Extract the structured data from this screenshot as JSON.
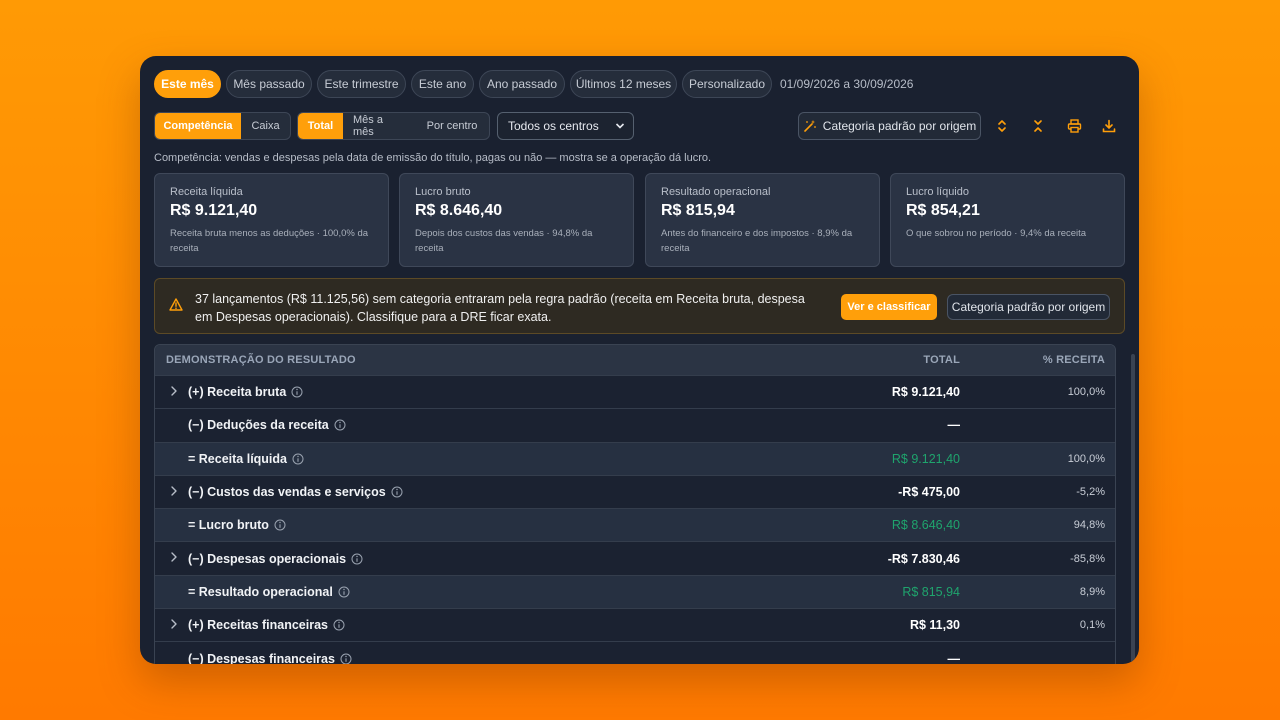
{
  "periods": [
    {
      "label": "Este mês",
      "active": true
    },
    {
      "label": "Mês passado",
      "active": false
    },
    {
      "label": "Este trimestre",
      "active": false
    },
    {
      "label": "Este ano",
      "active": false
    },
    {
      "label": "Ano passado",
      "active": false
    },
    {
      "label": "Últimos 12 meses",
      "active": false
    },
    {
      "label": "Personalizado",
      "active": false
    }
  ],
  "date_range": "01/09/2026 a 30/09/2026",
  "basis": {
    "competencia": "Competência",
    "caixa": "Caixa"
  },
  "view": {
    "total": "Total",
    "mes_a_mes": "Mês a mês",
    "por_centro": "Por centro"
  },
  "centro_select": "Todos os centros",
  "toolbar": {
    "categoria_padrao": "Categoria padrão por origem"
  },
  "note": "Competência: vendas e despesas pela data de emissão do título, pagas ou não — mostra se a operação dá lucro.",
  "cards": [
    {
      "label": "Receita líquida",
      "value": "R$ 9.121,40",
      "sub": "Receita bruta menos as deduções · 100,0% da receita"
    },
    {
      "label": "Lucro bruto",
      "value": "R$ 8.646,40",
      "sub": "Depois dos custos das vendas · 94,8% da receita"
    },
    {
      "label": "Resultado operacional",
      "value": "R$ 815,94",
      "sub": "Antes do financeiro e dos impostos · 8,9% da receita"
    },
    {
      "label": "Lucro líquido",
      "value": "R$ 854,21",
      "sub": "O que sobrou no período · 9,4% da receita"
    }
  ],
  "warning": {
    "text": "37 lançamentos (R$ 11.125,56) sem categoria entraram pela regra padrão (receita em Receita bruta, despesa em Despesas operacionais). Classifique para a DRE ficar exata.",
    "primary": "Ver e classificar",
    "secondary": "Categoria padrão por origem"
  },
  "table": {
    "headers": {
      "name": "DEMONSTRAÇÃO DO RESULTADO",
      "total": "TOTAL",
      "pct": "% RECEITA"
    },
    "rows": [
      {
        "name": "(+) Receita bruta",
        "total": "R$ 9.121,40",
        "pct": "100,0%",
        "expandable": true,
        "subtotal": false
      },
      {
        "name": "(−) Deduções da receita",
        "total": "—",
        "pct": "",
        "expandable": false,
        "subtotal": false
      },
      {
        "name": "= Receita líquida",
        "total": "R$ 9.121,40",
        "pct": "100,0%",
        "expandable": false,
        "subtotal": true
      },
      {
        "name": "(−) Custos das vendas e serviços",
        "total": "-R$ 475,00",
        "pct": "-5,2%",
        "expandable": true,
        "subtotal": false
      },
      {
        "name": "= Lucro bruto",
        "total": "R$ 8.646,40",
        "pct": "94,8%",
        "expandable": false,
        "subtotal": true
      },
      {
        "name": "(−) Despesas operacionais",
        "total": "-R$ 7.830,46",
        "pct": "-85,8%",
        "expandable": true,
        "subtotal": false
      },
      {
        "name": "= Resultado operacional",
        "total": "R$ 815,94",
        "pct": "8,9%",
        "expandable": false,
        "subtotal": true
      },
      {
        "name": "(+) Receitas financeiras",
        "total": "R$ 11,30",
        "pct": "0,1%",
        "expandable": true,
        "subtotal": false
      },
      {
        "name": "(−) Despesas financeiras",
        "total": "—",
        "pct": "",
        "expandable": false,
        "subtotal": false
      }
    ]
  },
  "colors": {
    "accent": "#ff9f0a",
    "positive": "#1fa46d",
    "panel": "#1a2130"
  }
}
